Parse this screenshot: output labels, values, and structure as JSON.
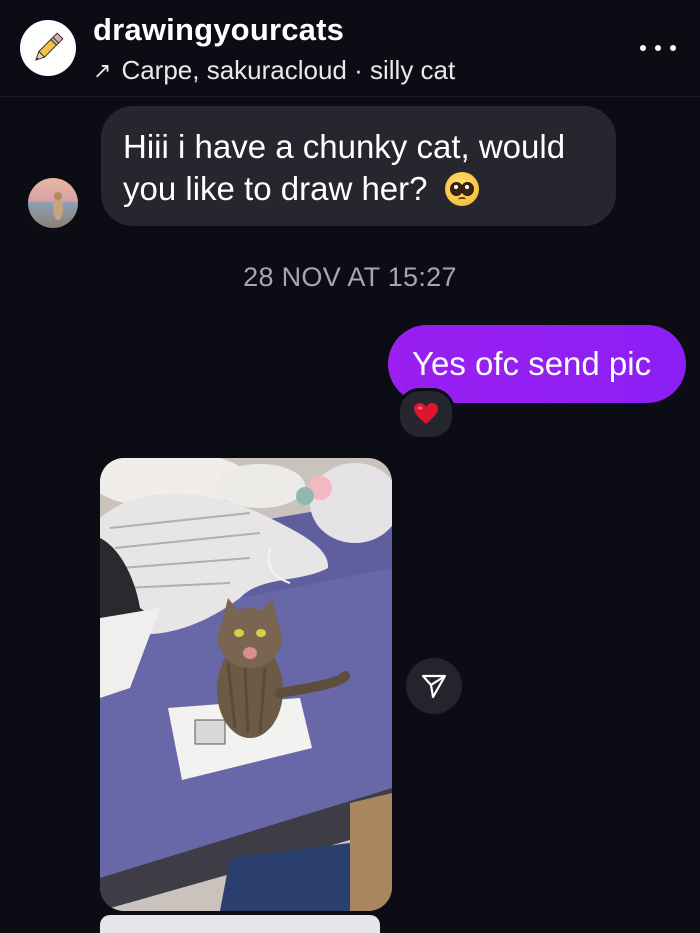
{
  "header": {
    "username": "drawingyourcats",
    "subtitle": "Carpe, sakuracloud · silly cat",
    "subtitle_arrow": "↗",
    "avatar_icon": "pencil-icon",
    "more_icon": "more-icon"
  },
  "messages": {
    "incoming": {
      "text": "Hiii i have a chunky cat, would you like to draw her?",
      "emoji": "pleading-face-icon"
    },
    "timestamp": "28 NOV AT 15:27",
    "outgoing": {
      "text": "Yes ofc send pic",
      "reaction": "red-heart-icon"
    },
    "photo": {
      "subject": "cat-photo",
      "share_icon": "share-icon"
    }
  },
  "colors": {
    "background": "#0c0c14",
    "incoming_bubble": "#26262e",
    "outgoing_bubble": "#8c1ff5",
    "timestamp": "#a6a6b0"
  }
}
